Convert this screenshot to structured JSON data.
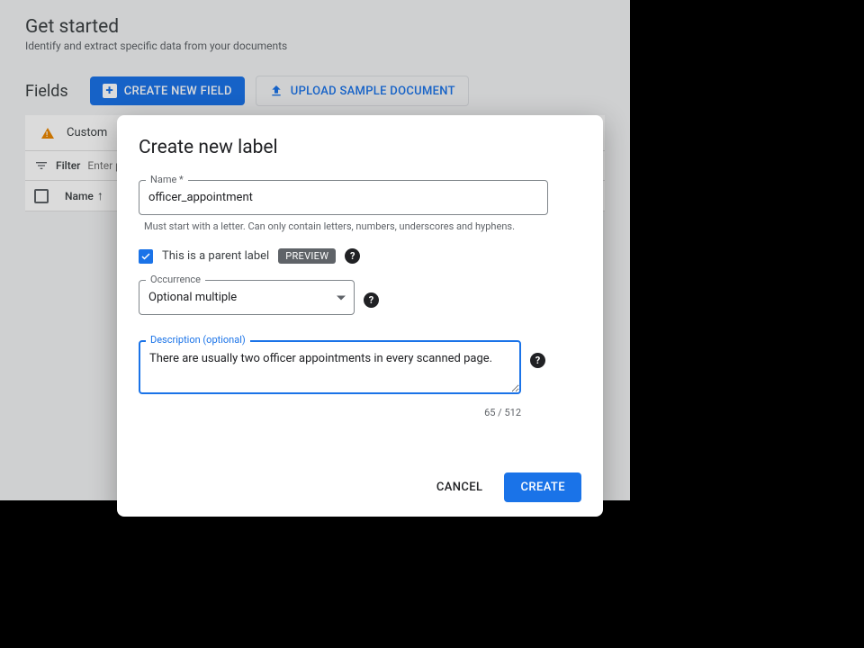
{
  "header": {
    "title": "Get started",
    "subtitle": "Identify and extract specific data from your documents"
  },
  "toolbar": {
    "section_heading": "Fields",
    "create_field_label": "CREATE NEW FIELD",
    "upload_doc_label": "UPLOAD SAMPLE DOCUMENT"
  },
  "notice": {
    "text": "Custom"
  },
  "filter": {
    "label": "Filter",
    "placeholder": "Enter pr"
  },
  "table": {
    "col_name": "Name"
  },
  "modal": {
    "title": "Create new label",
    "name": {
      "label": "Name *",
      "value": "officer_appointment",
      "helper": "Must start with a letter. Can only contain letters, numbers, underscores and hyphens."
    },
    "parent_checkbox": {
      "label": "This is a parent label",
      "badge": "PREVIEW"
    },
    "occurrence": {
      "label": "Occurrence",
      "value": "Optional multiple"
    },
    "description": {
      "label": "Description (optional)",
      "value": "There are usually two officer appointments in every scanned page.",
      "count": "65 / 512"
    },
    "actions": {
      "cancel": "CANCEL",
      "create": "CREATE"
    }
  }
}
